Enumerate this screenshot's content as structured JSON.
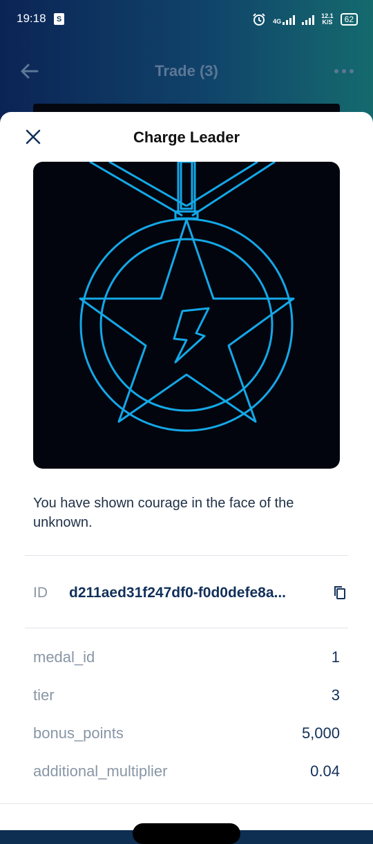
{
  "status_bar": {
    "time": "19:18",
    "shop_icon_letter": "S",
    "network_type": "4G",
    "speed_value": "12.1",
    "speed_unit": "K/S",
    "battery": "62",
    "icons": [
      "alarm-icon",
      "signal-icon",
      "battery-icon"
    ]
  },
  "app_bar": {
    "title": "Trade (3)",
    "back_icon": "arrow-left-icon",
    "menu_icon": "more-horizontal-icon"
  },
  "sheet": {
    "title": "Charge Leader",
    "close_icon": "close-icon",
    "image_icon": "medal-star-lightning-icon",
    "description": "You have shown courage in the face of the unknown.",
    "id_label": "ID",
    "id_value": "d211aed31f247df0-f0d0defe8a...",
    "copy_icon": "copy-icon",
    "properties": [
      {
        "key": "medal_id",
        "value": "1"
      },
      {
        "key": "tier",
        "value": "3"
      },
      {
        "key": "bonus_points",
        "value": "5,000"
      },
      {
        "key": "additional_multiplier",
        "value": "0.04"
      }
    ]
  },
  "colors": {
    "accent": "#13a8e8",
    "text_primary": "#12305a",
    "text_secondary": "#8996a6"
  }
}
